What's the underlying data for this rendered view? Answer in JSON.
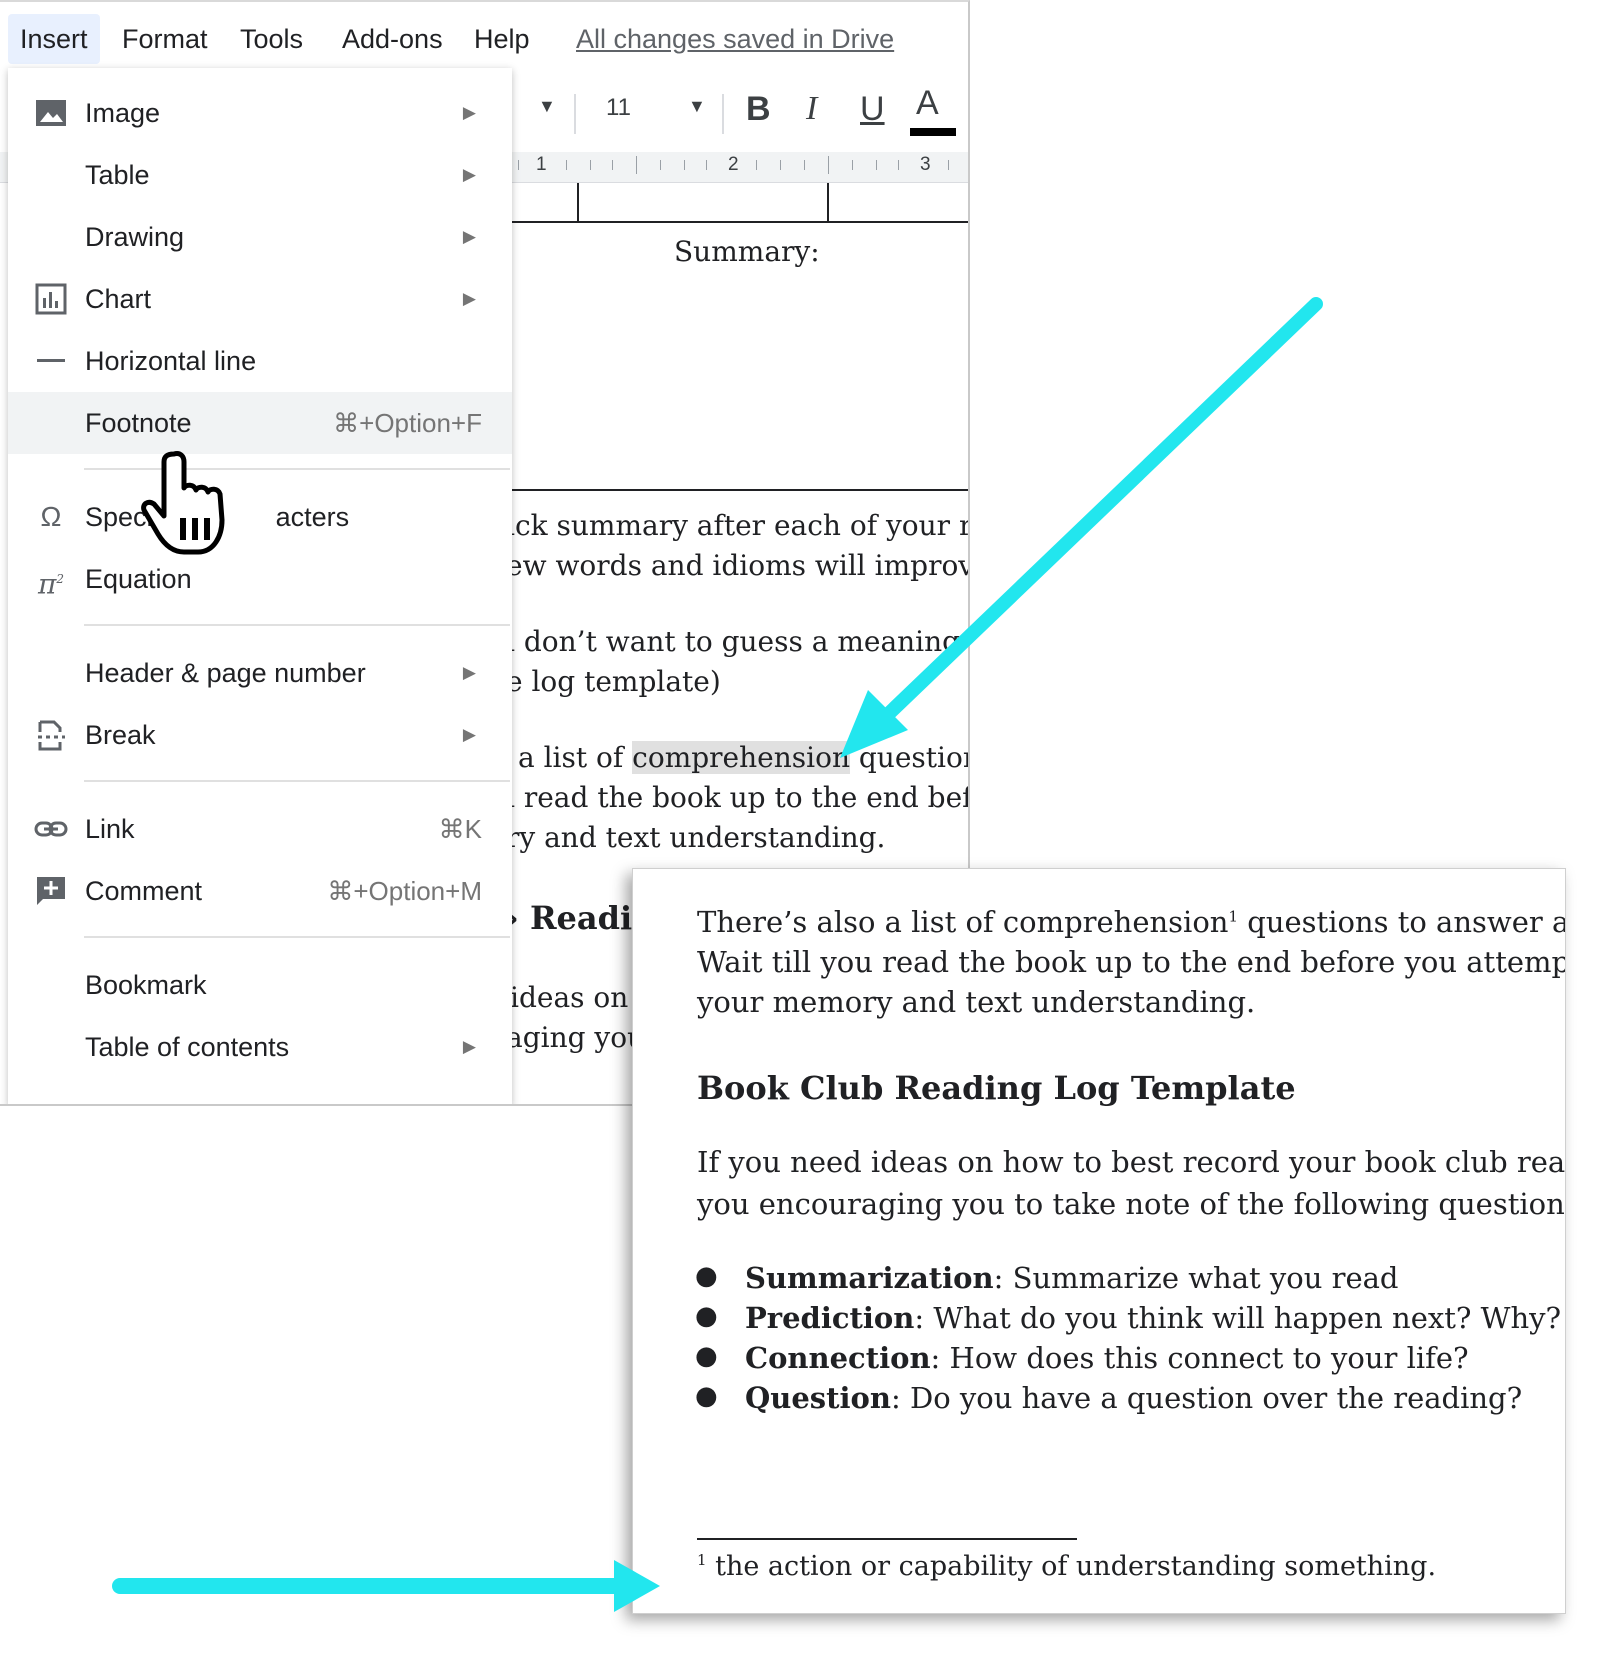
{
  "menubar": {
    "items": [
      "Insert",
      "Format",
      "Tools",
      "Add-ons",
      "Help"
    ],
    "saved_status": "All changes saved in Drive"
  },
  "toolbar": {
    "font_size": "11",
    "bold_label": "B",
    "italic_label": "I",
    "underline_label": "U",
    "text_color_label": "A"
  },
  "ruler": {
    "numbers": [
      "1",
      "2",
      "3"
    ]
  },
  "doc_background": {
    "summary_label": "Summary:",
    "lines": [
      "ick summary after each of your re",
      "ew words and idioms will improve",
      "ı don’t want to guess a meaning",
      "e log template)",
      "ry and text understanding."
    ],
    "line_comp_prefix": "a list of ",
    "line_comp_highlight": "comprehension",
    "line_comp_suffix": " questions",
    "line_read": "ı read the book up to the end befo",
    "heading_fragment": "› Readin",
    "ideas_fragment": "ideas on h",
    "aging_fragment": "aging you"
  },
  "insert_menu": {
    "items": [
      {
        "label": "Image",
        "icon": "image-icon",
        "submenu": true
      },
      {
        "label": "Table",
        "icon": "",
        "submenu": true
      },
      {
        "label": "Drawing",
        "icon": "",
        "submenu": true
      },
      {
        "label": "Chart",
        "icon": "chart-icon",
        "submenu": true
      },
      {
        "label": "Horizontal line",
        "icon": "horizontal-line-icon",
        "submenu": false
      },
      {
        "label": "Footnote",
        "icon": "",
        "shortcut": "⌘+Option+F",
        "highlighted": true
      },
      {
        "label": "Special characters",
        "icon": "omega-icon"
      },
      {
        "label": "Equation",
        "icon": "pi-icon"
      },
      {
        "label": "Header & page number",
        "icon": "",
        "submenu": true
      },
      {
        "label": "Break",
        "icon": "break-icon",
        "submenu": true
      },
      {
        "label": "Link",
        "icon": "link-icon",
        "shortcut": "⌘K"
      },
      {
        "label": "Comment",
        "icon": "comment-add-icon",
        "shortcut": "⌘+Option+M"
      },
      {
        "label": "Bookmark",
        "icon": ""
      },
      {
        "label": "Table of contents",
        "icon": "",
        "submenu": true
      }
    ],
    "special_visible_left": "Specia",
    "special_visible_right": "acters"
  },
  "zoomed_page": {
    "para1_a": "There’s also a list of comprehension",
    "para1_sup": "1",
    "para1_b": " questions to answer after yo",
    "para1_line2": "Wait till you read the book up to the end before you attempt to a",
    "para1_line3": "your memory and text understanding.",
    "heading": "Book Club Reading Log Template",
    "para2_line1": "If you need ideas on how to best record your book club reading,",
    "para2_line2": "you encouraging you to take note of the following questions:",
    "bullets": [
      {
        "term": "Summarization",
        "text": ": Summarize what you read"
      },
      {
        "term": "Prediction",
        "text": ": What do you think will happen next? Why?"
      },
      {
        "term": "Connection",
        "text": ": How does this connect to your life?"
      },
      {
        "term": "Question",
        "text": ": Do you have a question over the reading?"
      }
    ],
    "footnote_sup": "1",
    "footnote_text": " the action or capability of understanding something."
  },
  "colors": {
    "arrow": "#22e6ee",
    "menu_active_bg": "#e8f0fe",
    "menu_hover_bg": "#f1f3f4",
    "highlight_bg": "#e0e0e0"
  }
}
